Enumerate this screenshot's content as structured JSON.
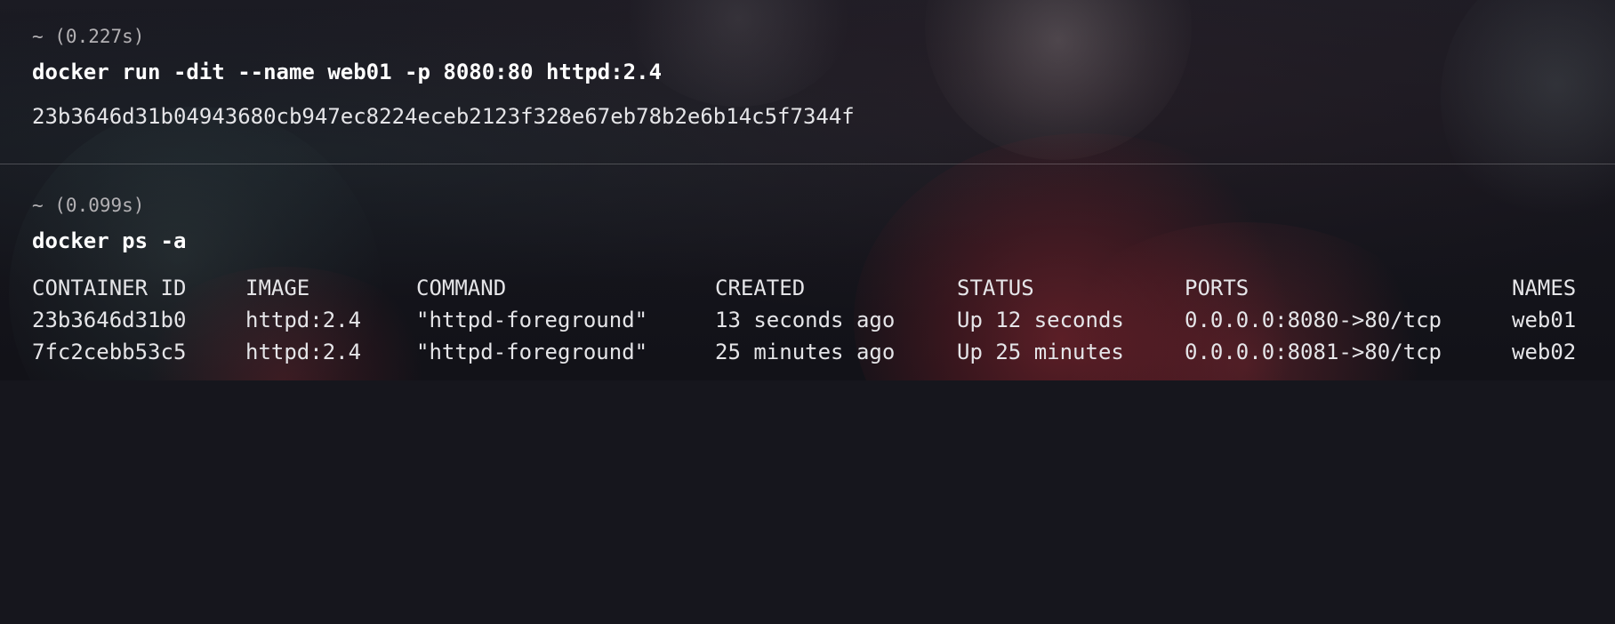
{
  "blocks": [
    {
      "prompt": "~ (0.227s)",
      "command": "docker run -dit --name web01 -p 8080:80 httpd:2.4",
      "output": "23b3646d31b04943680cb947ec8224eceb2123f328e67eb78b2e6b14c5f7344f"
    },
    {
      "prompt": "~ (0.099s)",
      "command": "docker ps -a",
      "table": {
        "headers": [
          "CONTAINER ID",
          "IMAGE",
          "COMMAND",
          "CREATED",
          "STATUS",
          "PORTS",
          "NAMES"
        ],
        "rows": [
          [
            "23b3646d31b0",
            "httpd:2.4",
            "\"httpd-foreground\"",
            "13 seconds ago",
            "Up 12 seconds",
            "0.0.0.0:8080->80/tcp",
            "web01"
          ],
          [
            "7fc2cebb53c5",
            "httpd:2.4",
            "\"httpd-foreground\"",
            "25 minutes ago",
            "Up 25 minutes",
            "0.0.0.0:8081->80/tcp",
            "web02"
          ]
        ]
      }
    }
  ]
}
